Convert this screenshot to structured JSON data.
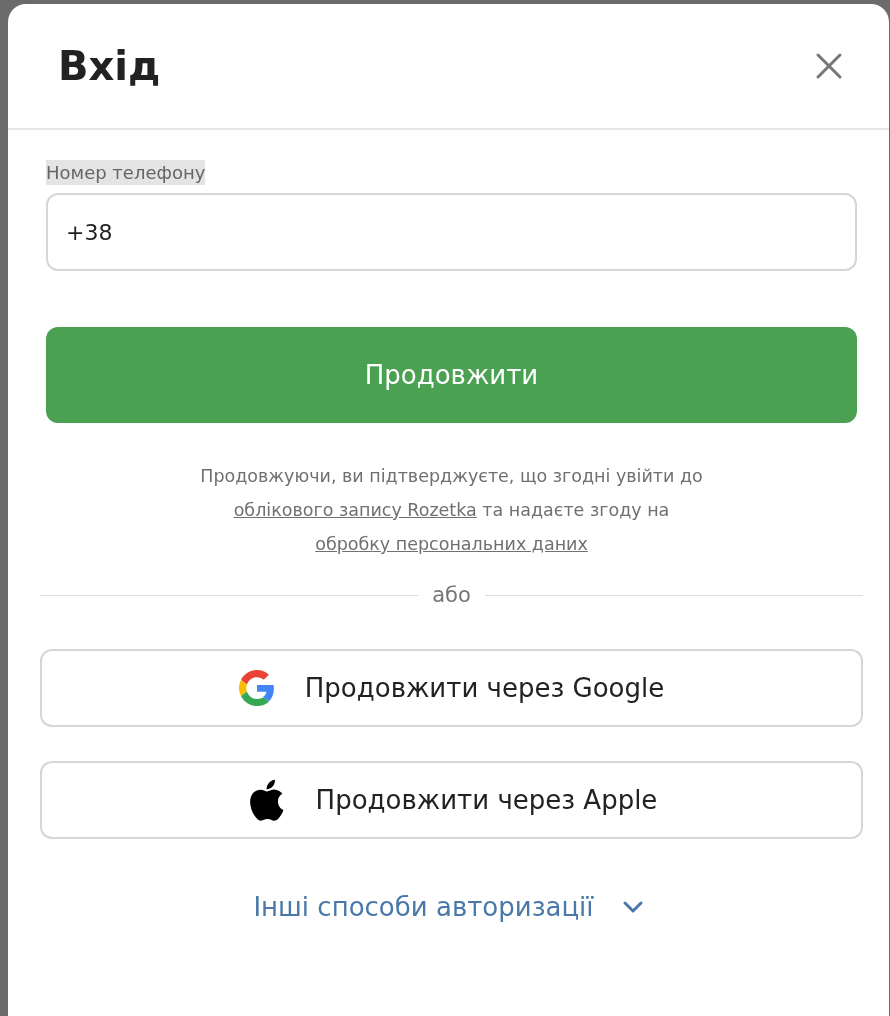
{
  "dialog": {
    "title": "Вхід"
  },
  "phone_field": {
    "label": "Номер телефону",
    "value": "+38"
  },
  "continue_button": {
    "label": "Продовжити"
  },
  "consent": {
    "before": "Продовжуючи, ви підтверджуєте, що згодні увійти до",
    "link_1": "облікового запису Rozetka",
    "middle": "та надаєте згоду на",
    "link_2": "обробку персональних даних"
  },
  "separator": "або",
  "social_buttons": [
    {
      "kind": "google",
      "label": "Продовжити через Google"
    },
    {
      "kind": "apple",
      "label": "Продовжити через Apple"
    }
  ],
  "more_options": {
    "label": "Інші способи авторизації",
    "expanded": false
  }
}
